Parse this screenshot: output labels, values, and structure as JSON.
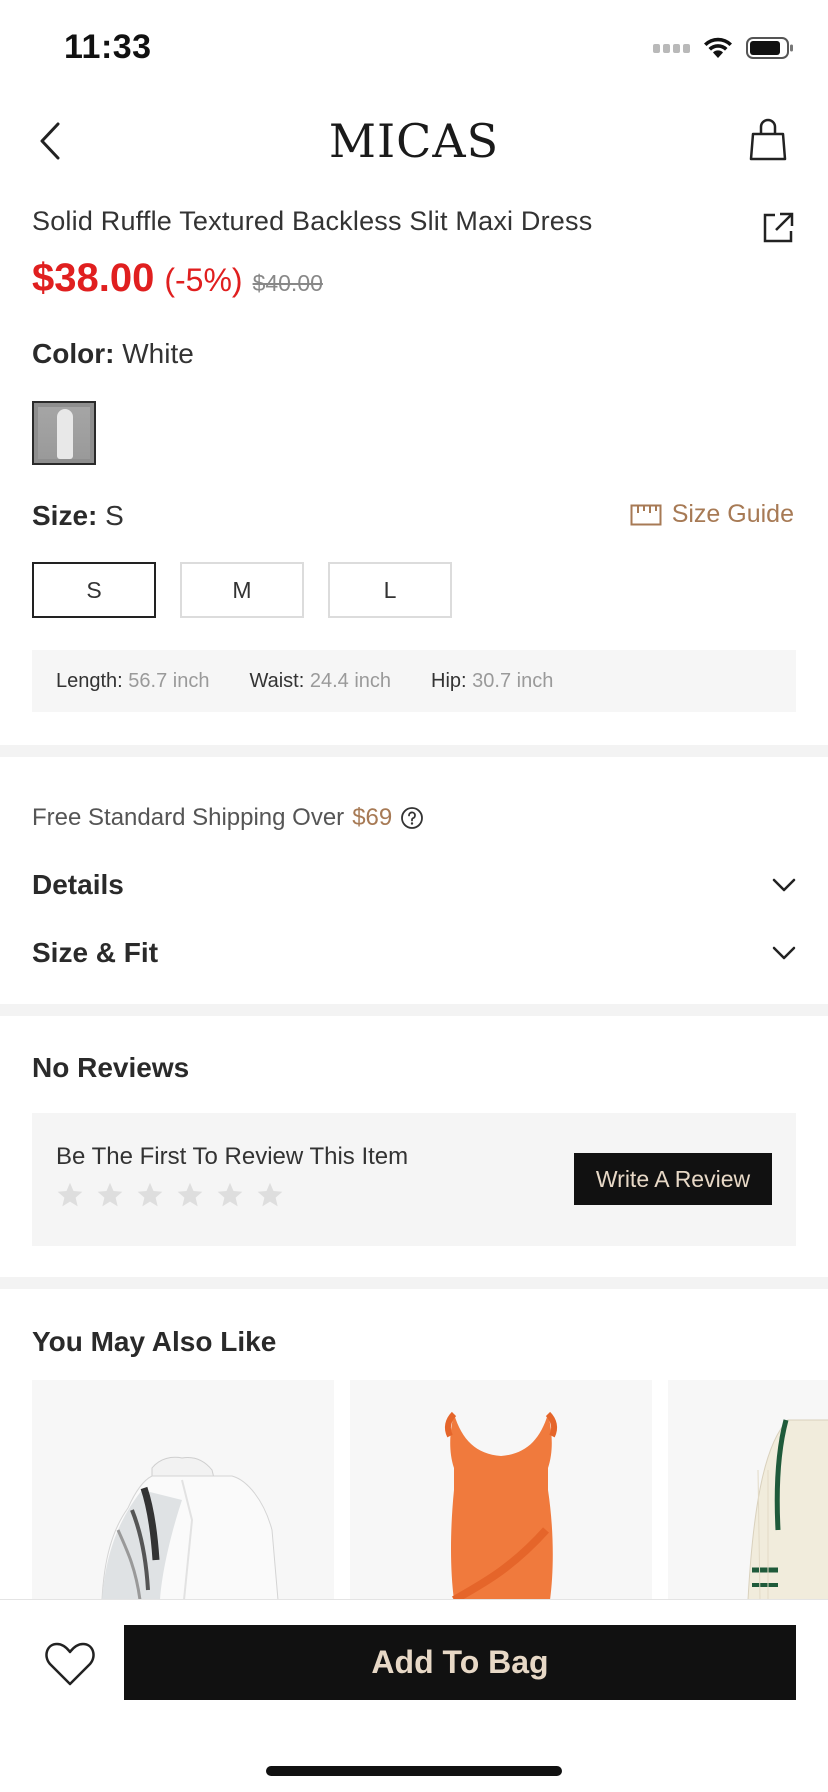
{
  "status": {
    "time": "11:33"
  },
  "nav": {
    "brand": "MICAS"
  },
  "product": {
    "title": "Solid Ruffle Textured Backless Slit Maxi Dress",
    "price": "$38.00",
    "discount": "(-5%)",
    "original_price": "$40.00"
  },
  "color": {
    "label": "Color:",
    "value": "White"
  },
  "size": {
    "label": "Size:",
    "value": "S",
    "guide_label": "Size Guide",
    "options": [
      "S",
      "M",
      "L"
    ],
    "selected": "S"
  },
  "measurements": [
    {
      "label": "Length:",
      "value": "56.7 inch"
    },
    {
      "label": "Waist:",
      "value": "24.4 inch"
    },
    {
      "label": "Hip:",
      "value": "30.7 inch"
    }
  ],
  "shipping": {
    "text": "Free Standard Shipping Over",
    "amount": "$69"
  },
  "sections": {
    "details": "Details",
    "size_fit": "Size & Fit"
  },
  "reviews": {
    "title": "No Reviews",
    "prompt": "Be The First To Review This Item",
    "star_count": 6,
    "write_label": "Write A Review"
  },
  "recommendations": {
    "title": "You May Also Like"
  },
  "bottom": {
    "add_to_bag": "Add To Bag"
  },
  "colors": {
    "accent_gold": "#a77a55",
    "price_red": "#e01f1f",
    "button_black": "#111111",
    "button_text": "#e7d8c6"
  }
}
